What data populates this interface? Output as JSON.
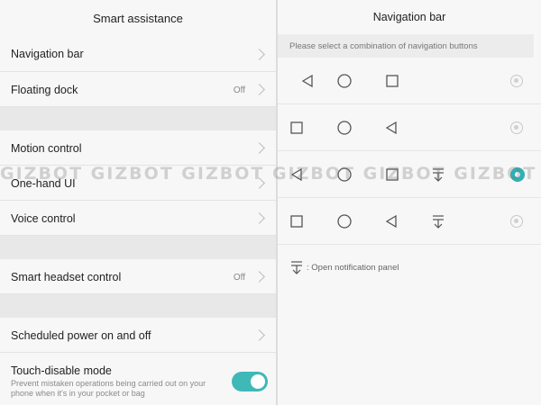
{
  "left": {
    "title": "Smart assistance",
    "items": [
      {
        "label": "Navigation bar",
        "value": ""
      },
      {
        "label": "Floating dock",
        "value": "Off"
      },
      {
        "label": "Motion control",
        "value": ""
      },
      {
        "label": "One-hand UI",
        "value": ""
      },
      {
        "label": "Voice control",
        "value": ""
      },
      {
        "label": "Smart headset control",
        "value": "Off"
      },
      {
        "label": "Scheduled power on and off",
        "value": ""
      }
    ],
    "touch_disable": {
      "label": "Touch-disable mode",
      "description": "Prevent mistaken operations being carried out on your phone when it's in your pocket or bag",
      "enabled": true
    }
  },
  "right": {
    "title": "Navigation bar",
    "hint": "Please select a combination of navigation buttons",
    "combos": [
      {
        "buttons": [
          "back-triangle-icon",
          "home-circle-icon",
          "recent-square-icon"
        ],
        "selected": false
      },
      {
        "buttons": [
          "recent-square-icon",
          "home-circle-icon",
          "back-triangle-icon"
        ],
        "selected": false
      },
      {
        "buttons": [
          "back-triangle-icon",
          "home-circle-icon",
          "recent-square-icon",
          "notification-pull-icon"
        ],
        "selected": true
      },
      {
        "buttons": [
          "recent-square-icon",
          "home-circle-icon",
          "back-triangle-icon",
          "notification-pull-icon"
        ],
        "selected": false
      }
    ],
    "legend_text": ": Open notification panel"
  },
  "watermark_text": "GIZBOT GIZBOT GIZBOT GIZBOT GIZBOT GIZBOT",
  "colors": {
    "accent": "#2fb0b4",
    "toggle": "#3fb8b8"
  }
}
